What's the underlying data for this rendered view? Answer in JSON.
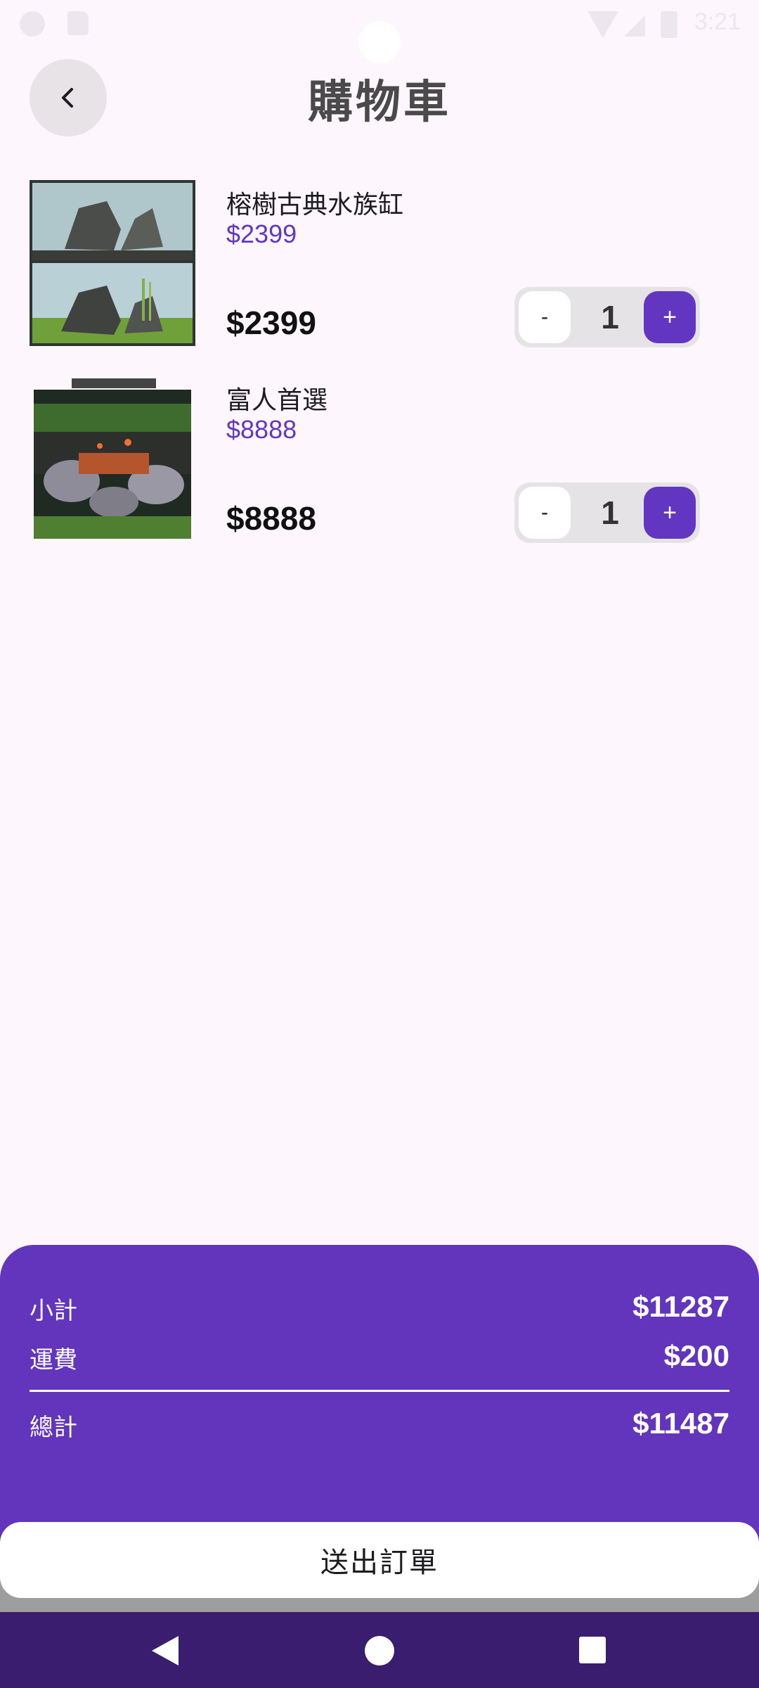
{
  "status_bar": {
    "time": "3:21",
    "icons": [
      "notification-icon",
      "sd-card-icon",
      "wifi-icon",
      "signal-icon",
      "battery-icon"
    ]
  },
  "header": {
    "title": "購物車",
    "back_icon": "chevron-left-icon"
  },
  "cart": {
    "items": [
      {
        "name": "榕樹古典水族缸",
        "unit_price": "$2399",
        "line_total": "$2399",
        "quantity": "1",
        "minus_label": "-",
        "plus_label": "+",
        "image": "aquarium-photo-rocks"
      },
      {
        "name": "富人首選",
        "unit_price": "$8888",
        "line_total": "$8888",
        "quantity": "1",
        "minus_label": "-",
        "plus_label": "+",
        "image": "aquarium-photo-plants"
      }
    ]
  },
  "summary": {
    "subtotal_label": "小計",
    "subtotal_value": "$11287",
    "shipping_label": "運費",
    "shipping_value": "$200",
    "total_label": "總計",
    "total_value": "$11487"
  },
  "submit": {
    "label": "送出訂單"
  },
  "nav_bar": {
    "icons": [
      "back-triangle-icon",
      "home-circle-icon",
      "recents-square-icon"
    ]
  },
  "colors": {
    "accent": "#6236C0",
    "summary_bg": "#6235BC",
    "nav_bg": "#3A1D6E",
    "page_bg": "#FDF6FD"
  }
}
